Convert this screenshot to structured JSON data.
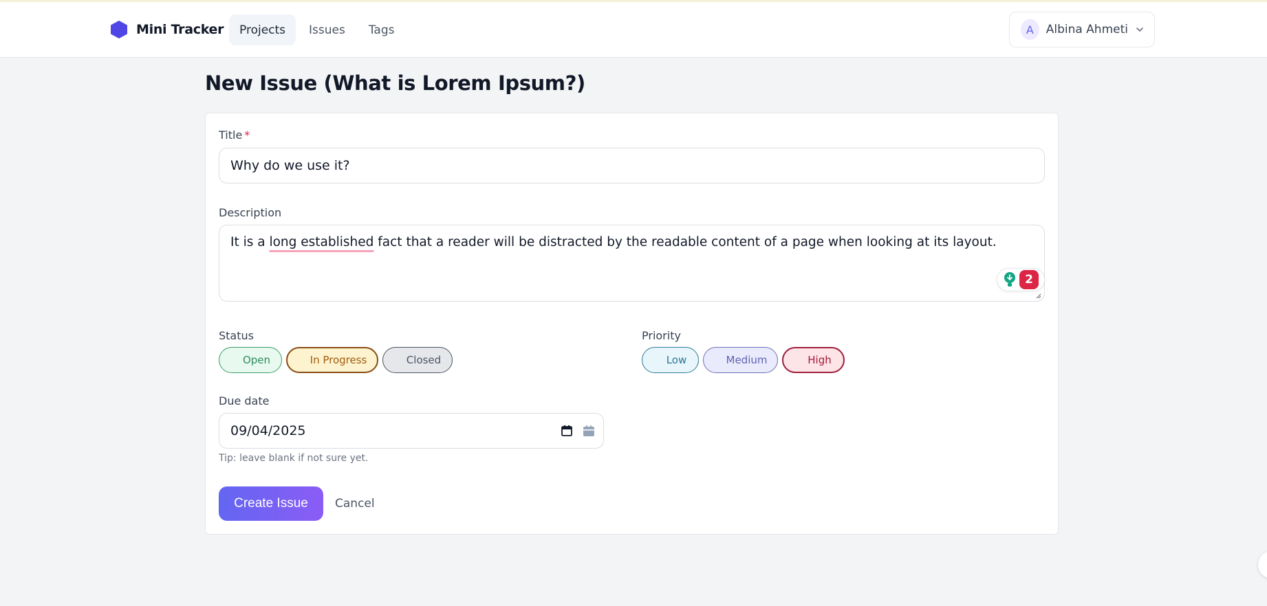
{
  "app": {
    "name": "Mini Tracker",
    "brand_color": "#4f46e5"
  },
  "nav": {
    "items": [
      {
        "label": "Projects",
        "active": true
      },
      {
        "label": "Issues",
        "active": false
      },
      {
        "label": "Tags",
        "active": false
      }
    ]
  },
  "user": {
    "initial": "A",
    "name": "Albina Ahmeti",
    "menu_icon": "chevron-down-icon"
  },
  "page": {
    "title": "New Issue (What is Lorem Ipsum?)"
  },
  "form": {
    "title_label": "Title",
    "required_marker": "*",
    "title_value": "Why do we use it?",
    "description_label": "Description",
    "description_parts": {
      "before": "It is a ",
      "flagged": "long established",
      "after": " fact that a reader will be distracted by the readable content of a page when looking at its layout."
    },
    "assistant_count": "2",
    "status_label": "Status",
    "status_options": [
      "Open",
      "In Progress",
      "Closed"
    ],
    "status_selected": "In Progress",
    "priority_label": "Priority",
    "priority_options": [
      "Low",
      "Medium",
      "High"
    ],
    "priority_selected": "High",
    "due_label": "Due date",
    "due_value": "09/04/2025",
    "due_tip": "Tip: leave blank if not sure yet.",
    "submit_label": "Create Issue",
    "cancel_label": "Cancel"
  },
  "colors": {
    "accent_start": "#6366f1",
    "accent_end": "#8b5cf6",
    "status_open": "#2f8a5f",
    "status_progress": "#a15c11",
    "status_closed": "#4b5563",
    "priority_low": "#2b7694",
    "priority_medium": "#5e62b0",
    "priority_high": "#a3193a"
  }
}
